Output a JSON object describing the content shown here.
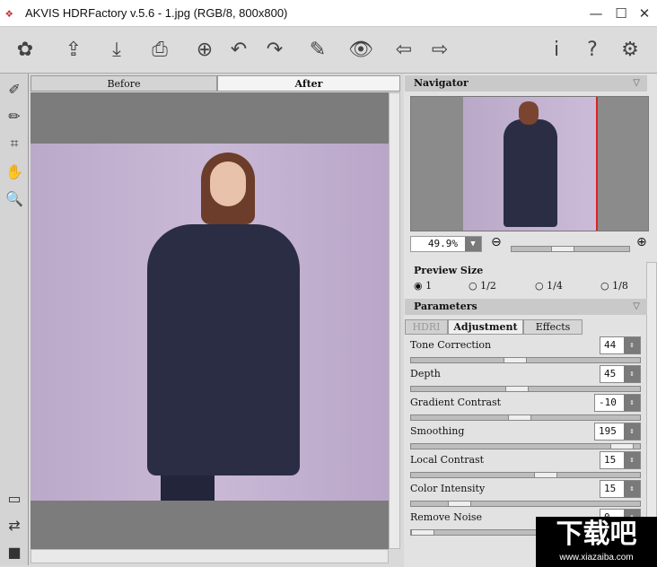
{
  "window": {
    "title": "AKVIS HDRFactory v.5.6 - 1.jpg (RGB/8, 800x800)",
    "minimize": "—",
    "maximize": "☐",
    "close": "✕"
  },
  "toolbar": {
    "icons": [
      "logo-icon",
      "open-icon",
      "save-icon",
      "print-icon",
      "export-icon",
      "undo-icon",
      "redo-icon",
      "brush-icon",
      "preview-icon",
      "back-icon",
      "forward-icon",
      "info-icon",
      "help-icon",
      "settings-icon"
    ],
    "glyphs": [
      "✿",
      "⇪",
      "⤓",
      "⎙",
      "⊕",
      "↶",
      "↷",
      "✎",
      "👁",
      "⇦",
      "⇨",
      "i",
      "?",
      "⚙"
    ]
  },
  "left_tools": {
    "glyphs": [
      "✐",
      "✏",
      "⌗",
      "✋",
      "🔍",
      "▭",
      "⇄",
      "■"
    ]
  },
  "view_tabs": {
    "before": "Before",
    "after": "After",
    "active": "After"
  },
  "navigator": {
    "title": "Navigator",
    "zoom": "49.9%",
    "minus": "⊖",
    "plus": "⊕"
  },
  "preview_size": {
    "title": "Preview Size",
    "options": [
      "1",
      "1/2",
      "1/4",
      "1/8"
    ],
    "selected": "1"
  },
  "parameters": {
    "title": "Parameters",
    "tabs": [
      "HDRI",
      "Adjustment",
      "Effects"
    ],
    "active_tab": "Adjustment",
    "items": [
      {
        "label": "Tone Correction",
        "value": "44",
        "fraction": 0.45
      },
      {
        "label": "Depth",
        "value": "45",
        "fraction": 0.46
      },
      {
        "label": "Gradient Contrast",
        "value": "-10",
        "fraction": 0.47
      },
      {
        "label": "Smoothing",
        "value": "195",
        "fraction": 0.97
      },
      {
        "label": "Local Contrast",
        "value": "15",
        "fraction": 0.6
      },
      {
        "label": "Color Intensity",
        "value": "15",
        "fraction": 0.18
      },
      {
        "label": "Remove Noise",
        "value": "0",
        "fraction": 0.0
      }
    ]
  },
  "watermark": {
    "text": "下载吧",
    "url": "www.xiazaiba.com"
  }
}
